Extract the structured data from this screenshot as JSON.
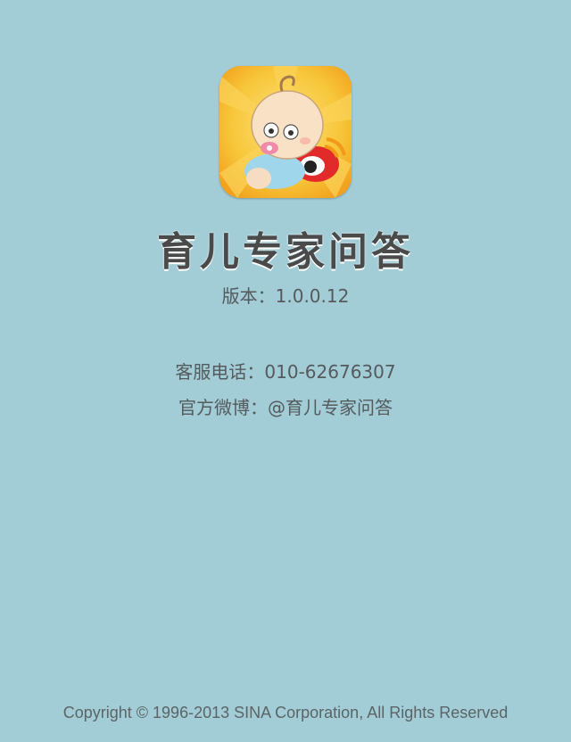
{
  "app": {
    "icon": "baby-app-icon",
    "title": "育儿专家问答",
    "version_label": "版本：",
    "version": "1.0.0.12"
  },
  "contact": {
    "phone_label": "客服电话：",
    "phone": "010-62676307",
    "weibo_label": "官方微博：",
    "weibo": "@育儿专家问答"
  },
  "footer": {
    "copyright": "Copyright © 1996-2013 SINA Corporation, All Rights Reserved"
  },
  "colors": {
    "background": "#a2ccd6",
    "text": "#555a5c",
    "title": "#4a4a4a",
    "icon_yellow": "#f7c63a",
    "icon_orange": "#f29a17"
  }
}
